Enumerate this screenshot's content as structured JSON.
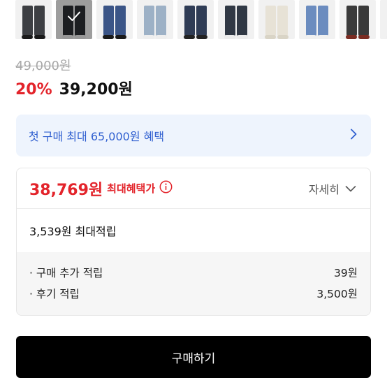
{
  "thumbnails": [
    {
      "color": "#3d3f43",
      "shoe": "#1a1a1a",
      "selected": false
    },
    {
      "color": "#2c2e33",
      "shoe": "#e8e8e8",
      "selected": true
    },
    {
      "color": "#3b5587",
      "shoe": "#1a1a1a",
      "selected": false
    },
    {
      "color": "#9db1c6",
      "shoe": "#eeeeee",
      "selected": false
    },
    {
      "color": "#2f3c55",
      "shoe": "#222222",
      "selected": false
    },
    {
      "color": "#303844",
      "shoe": "#ececec",
      "selected": false
    },
    {
      "color": "#e7e2d6",
      "shoe": "#d9d4c6",
      "selected": false
    },
    {
      "color": "#6b8cbf",
      "shoe": "#f0f0f0",
      "selected": false
    },
    {
      "color": "#3a3a3a",
      "shoe": "#7a2c22",
      "selected": false
    },
    {
      "color": "#353a45",
      "shoe": "#efefef",
      "selected": false
    }
  ],
  "price": {
    "original": "49,000원",
    "discount": "20%",
    "sale": "39,200원"
  },
  "benefit_banner": {
    "text": "첫 구매 최대 65,000원 혜택",
    "icon": "chevron-right-icon"
  },
  "max_benefit": {
    "price": "38,769원",
    "label": "최대혜택가",
    "info_icon": "info-icon",
    "detail_label": "자세히",
    "detail_icon": "chevron-down-icon",
    "points_total": "3,539원 최대적립",
    "rows": [
      {
        "label": "· 구매 추가 적립",
        "value": "39원"
      },
      {
        "label": "· 후기 적립",
        "value": "3,500원"
      }
    ]
  },
  "buy_button": {
    "label": "구매하기"
  },
  "colors": {
    "accent_red": "#e3242b",
    "accent_blue": "#2f5fd0",
    "banner_bg": "#eef4fd"
  }
}
